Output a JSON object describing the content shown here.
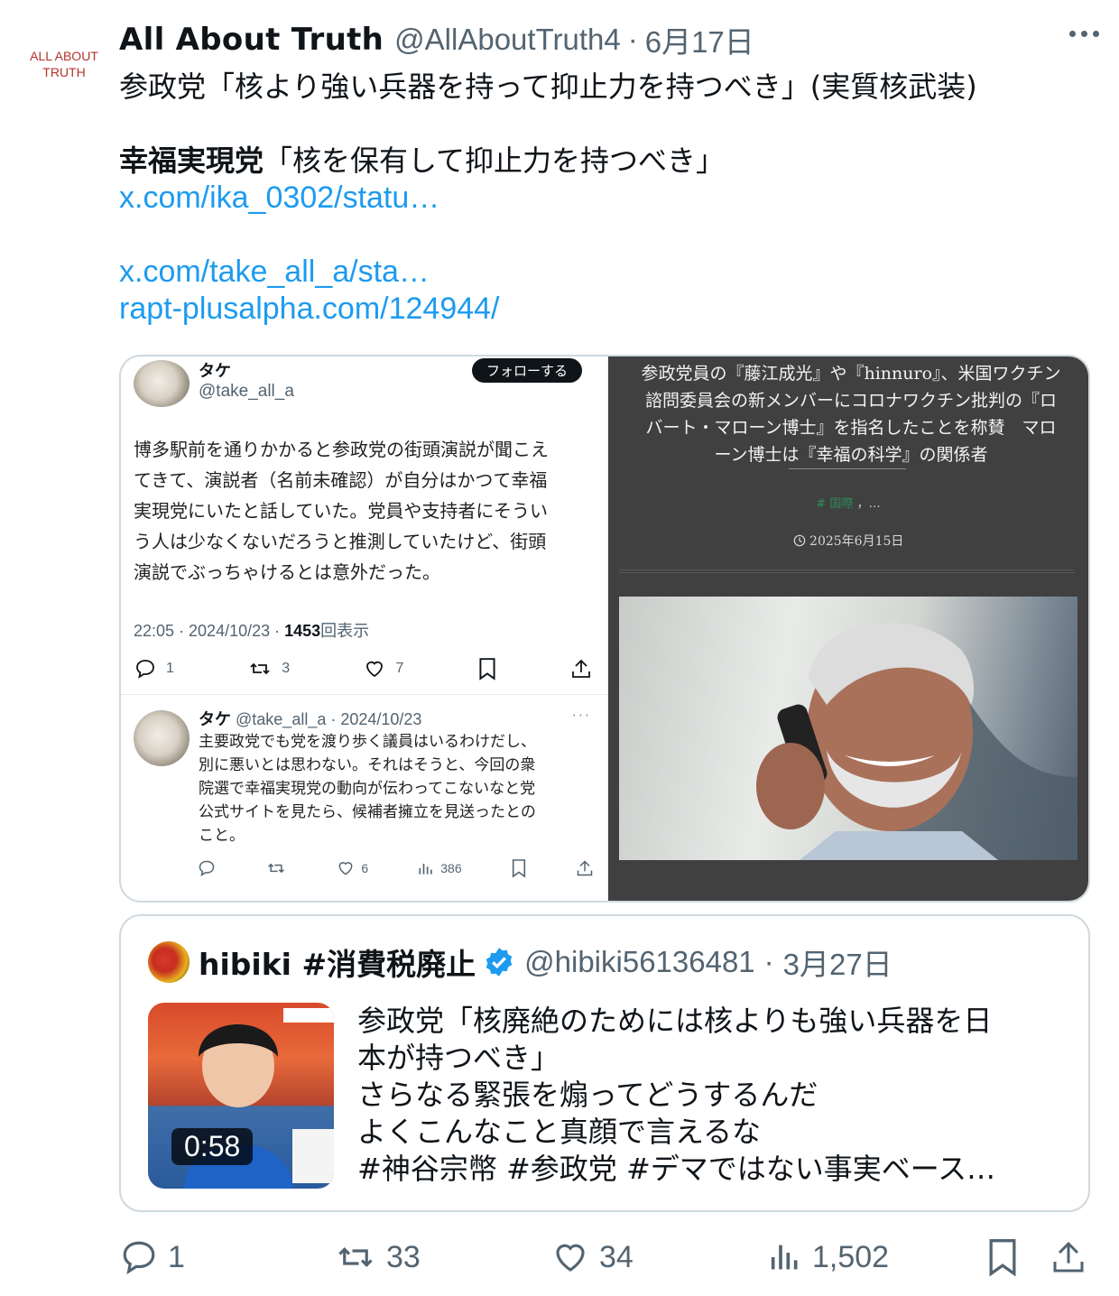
{
  "author": {
    "avatar_text_line1": "ALL ABOUT",
    "avatar_text_line2": "TRUTH",
    "name": "All About Truth",
    "handle": "@AllAboutTruth4",
    "separator": "·",
    "date": "6月17日"
  },
  "tweet": {
    "line1": "参政党「核より強い兵器を持って抑止力を持つべき」(実質核武装)",
    "line2_bold": "幸福実現党",
    "line2_rest": "「核を保有して抑止力を持つべき」",
    "link1": "x.com/ika_0302/statu…",
    "link2": "x.com/take_all_a/sta…",
    "link3": "rapt-plusalpha.com/124944/"
  },
  "media_left": {
    "name": "タケ",
    "handle": "@take_all_a",
    "follow_label": "フォローする",
    "body": [
      "博多駅前を通りかかると参政党の街頭演説が聞こえ",
      "てきて、演説者（名前未確認）が自分はかつて幸福",
      "実現党にいたと話していた。党員や支持者にそうい",
      "う人は少なくないだろうと推測していたけど、街頭",
      "演説でぶっちゃけるとは意外だった。"
    ],
    "meta_time": "22:05 · 2024/10/23 · ",
    "meta_views": "1453",
    "meta_views_label": "回表示",
    "stats": {
      "replies": "1",
      "retweets": "3",
      "likes": "7"
    },
    "reply": {
      "name": "タケ",
      "handle_date": "@take_all_a · 2024/10/23",
      "dots": "···",
      "body": [
        "主要政党でも党を渡り歩く議員はいるわけだし、",
        "別に悪いとは思わない。それはそうと、今回の衆",
        "院選で幸福実現党の動向が伝わってこないなと党",
        "公式サイトを見たら、候補者擁立を見送ったとの",
        "こと。"
      ],
      "likes": "6",
      "views": "386"
    }
  },
  "media_right": {
    "lines": [
      "参政党員の『藤江成光』や『hinnuro』、米国ワクチン",
      "諮問委員会の新メンバーにコロナワクチン批判の『ロ",
      "バート・マローン博士』を指名したことを称賛　マロ",
      "ーン博士は『幸福の科学』の関係者"
    ],
    "tag": "# 国際",
    "tag_more": "，…",
    "date": "2025年6月15日"
  },
  "quote": {
    "name": "hibiki #消費税廃止",
    "handle": "@hibiki56136481",
    "separator": "·",
    "date": "3月27日",
    "duration": "0:58",
    "lines": [
      "参政党「核廃絶のためには核よりも強い兵器を日",
      "本が持つべき」",
      "さらなる緊張を煽ってどうするんだ",
      "よくこんなこと真顔で言えるな",
      "#神谷宗幣 #参政党 #デマではない事実ベース…"
    ]
  },
  "actions": {
    "replies": "1",
    "retweets": "33",
    "likes": "34",
    "views": "1,502"
  },
  "colors": {
    "link": "#1d9bf0",
    "secondary_text": "#536471",
    "border": "#cfd9de",
    "verified": "#1d9bf0",
    "logo_red": "#b5322a"
  }
}
